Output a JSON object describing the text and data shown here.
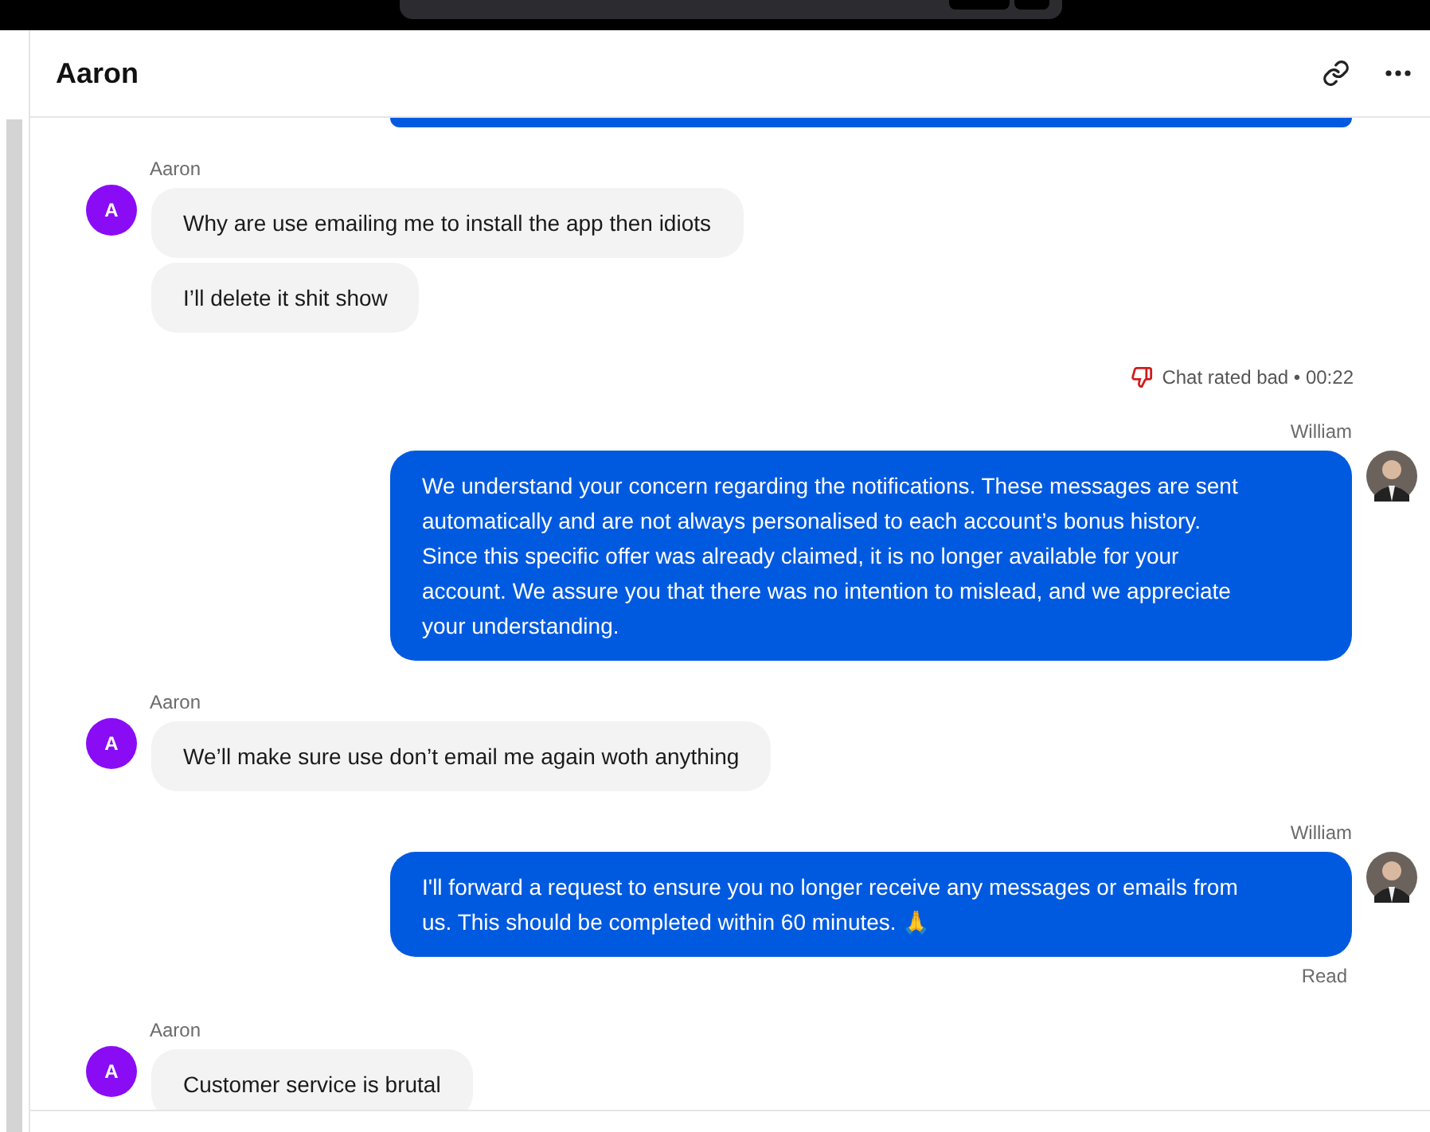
{
  "header": {
    "title": "Aaron"
  },
  "messages": [
    {
      "kind": "incoming",
      "sender": "Aaron",
      "avatar_letter": "A",
      "bubbles": [
        "Why are use emailing me to install the app then idiots",
        "I’ll delete it shit show"
      ]
    },
    {
      "kind": "rating",
      "text": "Chat rated bad • 00:22"
    },
    {
      "kind": "outgoing",
      "sender": "William",
      "text": "We understand your concern regarding the notifications. These messages are sent automatically and are not always personalised to each account’s bonus history. Since this specific offer was already claimed, it is no longer available for your account. We assure you that there was no intention to mislead, and we appreciate your understanding."
    },
    {
      "kind": "incoming",
      "sender": "Aaron",
      "avatar_letter": "A",
      "bubbles": [
        "We’ll make sure use don’t email me again woth anything"
      ]
    },
    {
      "kind": "outgoing",
      "sender": "William",
      "text": "I'll forward a request to ensure you no longer receive any messages or emails from us. This should be completed within 60 minutes. 🙏",
      "status": "Read"
    },
    {
      "kind": "incoming",
      "sender": "Aaron",
      "avatar_letter": "A",
      "bubbles": [
        "Customer service is brutal"
      ]
    }
  ]
}
